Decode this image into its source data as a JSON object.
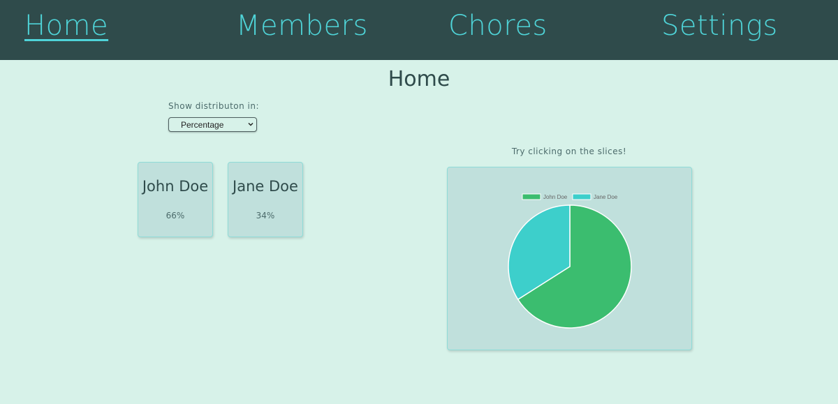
{
  "nav": {
    "items": [
      {
        "label": "Home",
        "active": true
      },
      {
        "label": "Members",
        "active": false
      },
      {
        "label": "Chores",
        "active": false
      },
      {
        "label": "Settings",
        "active": false
      }
    ]
  },
  "page": {
    "title": "Home",
    "distribution_label": "Show distributon in:",
    "distribution_select": {
      "value": "Percentage"
    },
    "hint": "Try clicking on the slices!"
  },
  "members": [
    {
      "name": "John Doe",
      "share": "66%"
    },
    {
      "name": "Jane Doe",
      "share": "34%"
    }
  ],
  "colors": {
    "nav_bg": "#2f4b4b",
    "nav_link": "#4fd4d8",
    "page_bg": "#d7f2e9",
    "card_bg": "#c0e0dc",
    "john": "#3bbd6f",
    "jane": "#3dcfcb"
  },
  "chart_data": {
    "type": "pie",
    "series": [
      {
        "name": "John Doe",
        "value": 66,
        "color": "#3bbd6f"
      },
      {
        "name": "Jane Doe",
        "value": 34,
        "color": "#3dcfcb"
      }
    ],
    "legend": "top"
  }
}
